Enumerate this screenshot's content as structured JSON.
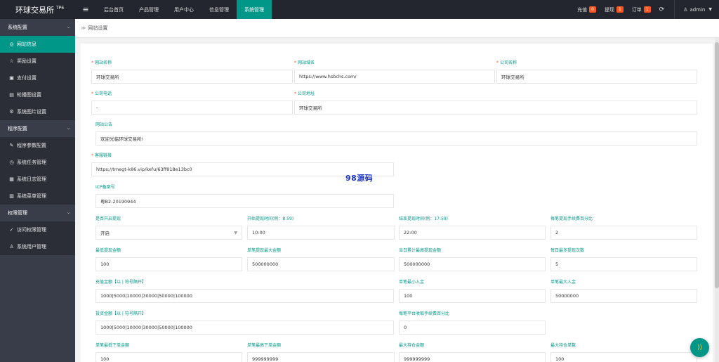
{
  "app": {
    "logo": "环球交易所",
    "logo_sup": "TP6",
    "menu_toggle": "≡"
  },
  "topnav": [
    {
      "label": "后台首页",
      "active": false
    },
    {
      "label": "产品管理",
      "active": false
    },
    {
      "label": "用户中心",
      "active": false
    },
    {
      "label": "信息管理",
      "active": false
    },
    {
      "label": "系统管理",
      "active": true
    }
  ],
  "topright": {
    "recharge": {
      "label": "充值",
      "count": "0"
    },
    "withdraw": {
      "label": "提现",
      "count": "1"
    },
    "orders": {
      "label": "订单",
      "count": "1"
    },
    "refresh_icon": "C",
    "user": "admin"
  },
  "sidebar": {
    "groups": [
      {
        "label": "系统配置",
        "items": [
          {
            "label": "网站信息",
            "icon": "globe-icon",
            "glyph": "◎",
            "active": true
          },
          {
            "label": "奖励设置",
            "icon": "star-icon",
            "glyph": "☆",
            "active": false
          },
          {
            "label": "支付设置",
            "icon": "card-icon",
            "glyph": "▣",
            "active": false
          },
          {
            "label": "轮播图设置",
            "icon": "image-icon",
            "glyph": "▤",
            "active": false
          },
          {
            "label": "系统图片设置",
            "icon": "gear-icon",
            "glyph": "⚙",
            "active": false
          }
        ]
      },
      {
        "label": "程序配置",
        "items": [
          {
            "label": "程序参数配置",
            "icon": "wrench-icon",
            "glyph": "✎",
            "active": false
          },
          {
            "label": "系统任务管理",
            "icon": "clock-icon",
            "glyph": "◷",
            "active": false
          },
          {
            "label": "系统日志管理",
            "icon": "calendar-icon",
            "glyph": "▦",
            "active": false
          },
          {
            "label": "系统菜单管理",
            "icon": "menu-icon",
            "glyph": "▥",
            "active": false
          }
        ]
      },
      {
        "label": "权限管理",
        "items": [
          {
            "label": "访问权限管理",
            "icon": "check-circle-icon",
            "glyph": "✓",
            "active": false
          },
          {
            "label": "系统用户管理",
            "icon": "user-icon",
            "glyph": "♙",
            "active": false
          }
        ]
      }
    ]
  },
  "breadcrumb": {
    "label": "网站设置"
  },
  "form": {
    "site_name": {
      "label": "网站名称",
      "value": "环球交易所"
    },
    "site_domain": {
      "label": "网站域名",
      "value": "https://www.hsbchs.com/"
    },
    "company_name": {
      "label": "公司名称",
      "value": "环球交易所"
    },
    "company_phone": {
      "label": "公司电话",
      "value": "-"
    },
    "company_address": {
      "label": "公司地址",
      "value": "环球交易所"
    },
    "site_notice": {
      "label": "网站公告",
      "value": "欢迎光临环球交易所!"
    },
    "service_link": {
      "label": "客服链接",
      "value": "https://tmegt-k86.vip/kefu/63ff818e13bc0"
    },
    "icp": {
      "label": "ICP备案号",
      "value": "粤B2-20190944"
    },
    "withdraw_open": {
      "label": "是否开启提现",
      "value": "开启"
    },
    "withdraw_start": {
      "label": "开始提现时间(例：8:59)",
      "value": "10:00"
    },
    "withdraw_end": {
      "label": "结束提现时间(例：17:59)",
      "value": "22:00"
    },
    "withdraw_fee": {
      "label": "每笔提现手续费百分比",
      "value": "2"
    },
    "withdraw_min": {
      "label": "最低提现金额",
      "value": "100"
    },
    "withdraw_max": {
      "label": "单笔提现最大金额",
      "value": "500000000"
    },
    "withdraw_day_max": {
      "label": "当日累计最高提现金额",
      "value": "500000000"
    },
    "withdraw_day_times": {
      "label": "每日最多提现次数",
      "value": "5"
    },
    "recharge_amounts": {
      "label": "充值金额【以 | 符号隔开】",
      "value": "1000|5000|10000|30000|50000|100000"
    },
    "deposit_min": {
      "label": "单笔最小入金",
      "value": "100"
    },
    "deposit_max": {
      "label": "单笔最大入金",
      "value": "50000000"
    },
    "invest_amounts": {
      "label": "投资金额【以 | 符号隔开】",
      "value": "1000|5000|10000|30000|50000|100000"
    },
    "platform_fee": {
      "label": "每笔平台收取手续费百分比",
      "value": "0"
    },
    "order_min": {
      "label": "单笔最低下单金额",
      "value": "100"
    },
    "order_max": {
      "label": "单笔最高下单金额",
      "value": "999999999"
    },
    "hold_max_amount": {
      "label": "最大持仓金额",
      "value": "999999999"
    },
    "hold_max_count": {
      "label": "最大持仓单数",
      "value": "100"
    }
  },
  "watermark": "98源码",
  "colors": {
    "accent": "#009688",
    "topbar": "#23262e",
    "sidebar": "#393d49",
    "badge": "#ff5722"
  }
}
